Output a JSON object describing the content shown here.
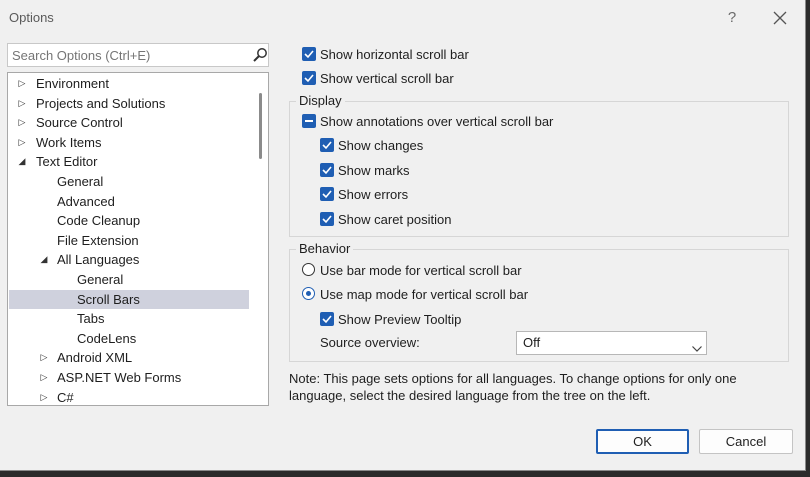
{
  "window": {
    "title": "Options",
    "help": "?"
  },
  "search": {
    "placeholder": "Search Options (Ctrl+E)"
  },
  "tree": [
    {
      "label": "Environment",
      "arrow": "▷",
      "level": 0
    },
    {
      "label": "Projects and Solutions",
      "arrow": "▷",
      "level": 0
    },
    {
      "label": "Source Control",
      "arrow": "▷",
      "level": 0
    },
    {
      "label": "Work Items",
      "arrow": "▷",
      "level": 0
    },
    {
      "label": "Text Editor",
      "arrow": "◢",
      "level": 0
    },
    {
      "label": "General",
      "arrow": "",
      "level": 2
    },
    {
      "label": "Advanced",
      "arrow": "",
      "level": 2
    },
    {
      "label": "Code Cleanup",
      "arrow": "",
      "level": 2
    },
    {
      "label": "File Extension",
      "arrow": "",
      "level": 2
    },
    {
      "label": "All Languages",
      "arrow": "◢",
      "level": 1
    },
    {
      "label": "General",
      "arrow": "",
      "level": 3
    },
    {
      "label": "Scroll Bars",
      "arrow": "",
      "level": 3,
      "selected": true
    },
    {
      "label": "Tabs",
      "arrow": "",
      "level": 3
    },
    {
      "label": "CodeLens",
      "arrow": "",
      "level": 3
    },
    {
      "label": "Android XML",
      "arrow": "▷",
      "level": 1
    },
    {
      "label": "ASP.NET Web Forms",
      "arrow": "▷",
      "level": 1
    },
    {
      "label": "C#",
      "arrow": "▷",
      "level": 1
    }
  ],
  "options": {
    "show_horizontal": "Show horizontal scroll bar",
    "show_vertical": "Show vertical scroll bar",
    "display_title": "Display",
    "show_annotations": "Show annotations over vertical scroll bar",
    "show_changes": "Show changes",
    "show_marks": "Show marks",
    "show_errors": "Show errors",
    "show_caret": "Show caret position",
    "behavior_title": "Behavior",
    "bar_mode": "Use bar mode for vertical scroll bar",
    "map_mode": "Use map mode for vertical scroll bar",
    "preview_tooltip": "Show Preview Tooltip",
    "source_overview_label": "Source overview:",
    "source_overview_value": "Off"
  },
  "note": "Note: This page sets options for all languages. To change options for only one language, select the desired language from the tree on the left.",
  "buttons": {
    "ok": "OK",
    "cancel": "Cancel"
  },
  "colors": {
    "accent": "#1f5eb3",
    "selection": "#cfd1dd"
  }
}
